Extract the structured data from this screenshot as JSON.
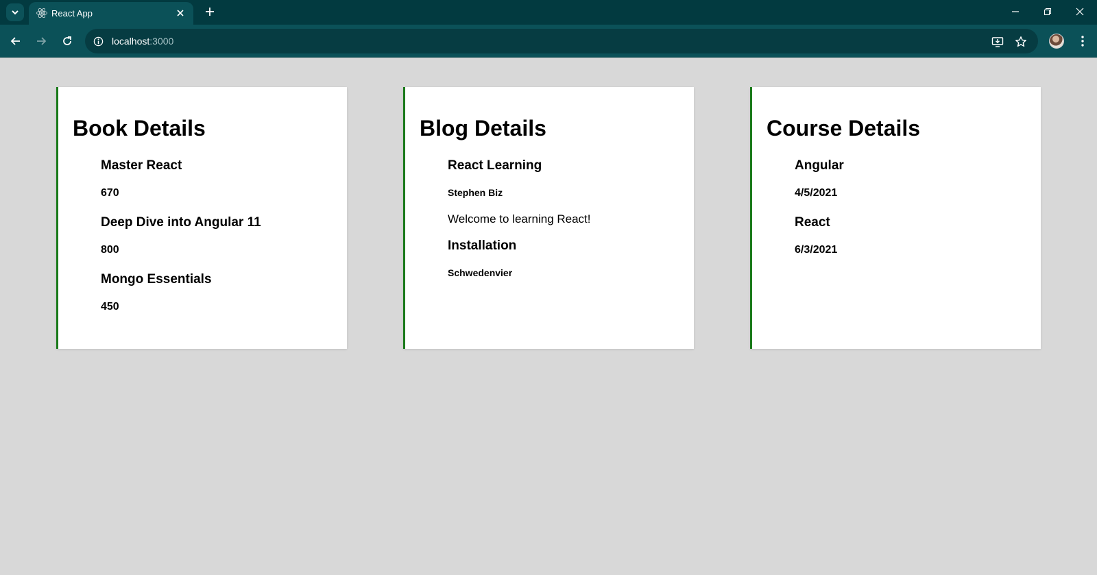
{
  "browser": {
    "tab_title": "React App",
    "url_host": "localhost",
    "url_port": ":3000",
    "accent": "#023a40",
    "toolbar_color": "#0b5158"
  },
  "icons": {
    "tab_search": "chevron-down-icon",
    "favicon": "react-logo-icon",
    "tab_close": "close-icon",
    "new_tab": "plus-icon",
    "minimize": "minimize-icon",
    "restore": "restore-icon",
    "close_window": "close-icon",
    "back": "arrow-left-icon",
    "forward": "arrow-right-icon",
    "reload": "reload-icon",
    "site_info": "info-icon",
    "install": "install-app-icon",
    "bookmark": "star-icon",
    "menu": "kebab-menu-icon"
  },
  "page": {
    "background": "#d8d8d8",
    "card_border_color": "#1a7a1a",
    "books": {
      "title": "Book Details",
      "items": [
        {
          "name": "Master React",
          "price": "670"
        },
        {
          "name": "Deep Dive into Angular 11",
          "price": "800"
        },
        {
          "name": "Mongo Essentials",
          "price": "450"
        }
      ]
    },
    "blogs": {
      "title": "Blog Details",
      "items": [
        {
          "title": "React Learning",
          "author": "Stephen Biz",
          "content": "Welcome to learning React!"
        },
        {
          "title": "Installation",
          "author": "Schwedenvier"
        }
      ]
    },
    "courses": {
      "title": "Course Details",
      "items": [
        {
          "name": "Angular",
          "date": "4/5/2021"
        },
        {
          "name": "React",
          "date": "6/3/2021"
        }
      ]
    }
  }
}
